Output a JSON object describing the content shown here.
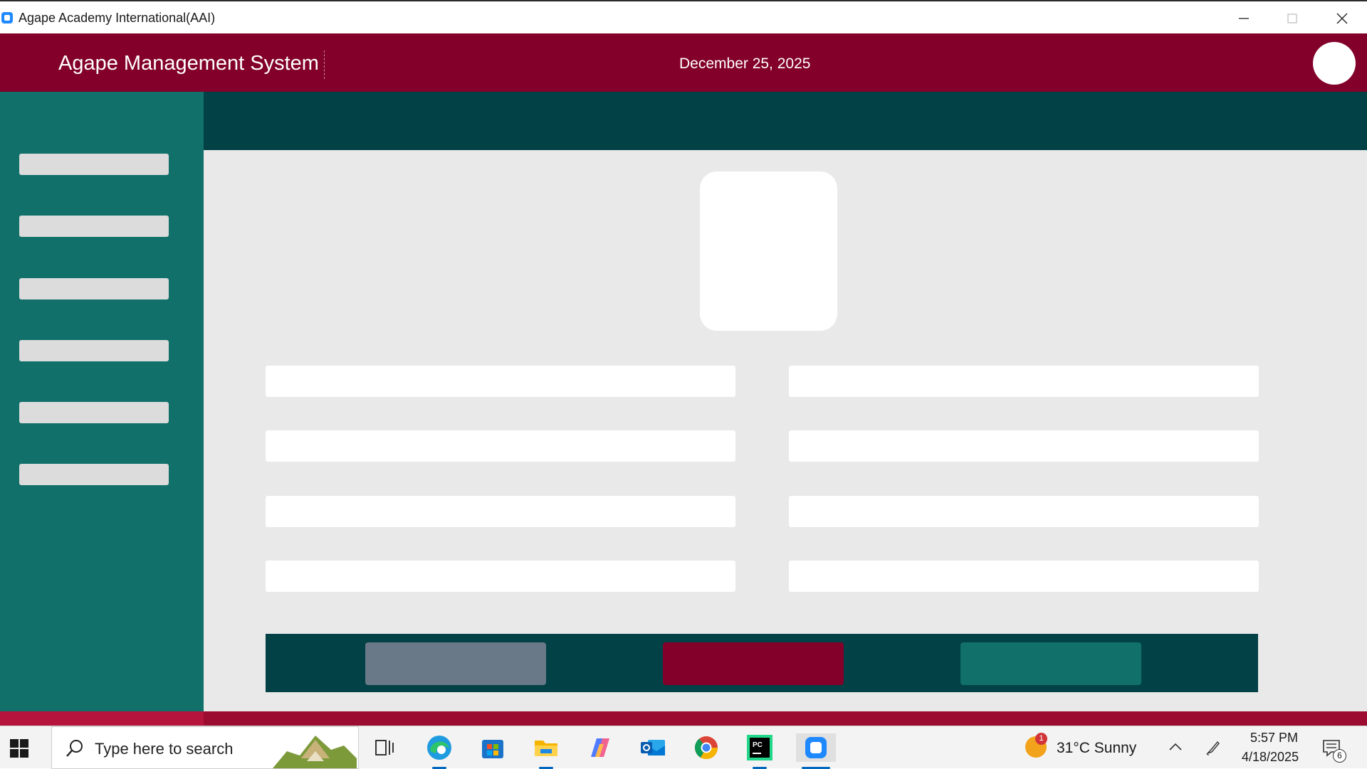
{
  "window": {
    "title": "Agape Academy International(AAI)",
    "icon": "app-icon",
    "controls": [
      "minimize-icon",
      "maximize-icon",
      "close-icon"
    ]
  },
  "header": {
    "title": "Agape Management System",
    "date": "December 25, 2025",
    "background": "#820029"
  },
  "sidebar": {
    "background": "#117069",
    "items": [
      {
        "label": ""
      },
      {
        "label": ""
      },
      {
        "label": ""
      },
      {
        "label": ""
      },
      {
        "label": ""
      },
      {
        "label": ""
      }
    ]
  },
  "topbar": {
    "background": "#024247"
  },
  "form": {
    "left_fields": [
      {
        "value": ""
      },
      {
        "value": ""
      },
      {
        "value": ""
      },
      {
        "value": ""
      }
    ],
    "right_fields": [
      {
        "value": ""
      },
      {
        "value": ""
      },
      {
        "value": ""
      },
      {
        "value": ""
      }
    ]
  },
  "actions": {
    "buttons": [
      {
        "label": "",
        "color": "#697987"
      },
      {
        "label": "",
        "color": "#820029"
      },
      {
        "label": "",
        "color": "#117069"
      }
    ]
  },
  "taskbar": {
    "search_placeholder": "Type here to search",
    "apps": [
      "task-view-icon",
      "edge-icon",
      "store-icon",
      "file-explorer-icon",
      "copilot-icon",
      "outlook-icon",
      "chrome-icon",
      "pycharm-icon",
      "app-icon"
    ],
    "weather_badge": "1",
    "weather": "31°C  Sunny",
    "time": "5:57 PM",
    "date": "4/18/2025",
    "notification_count": "6"
  }
}
